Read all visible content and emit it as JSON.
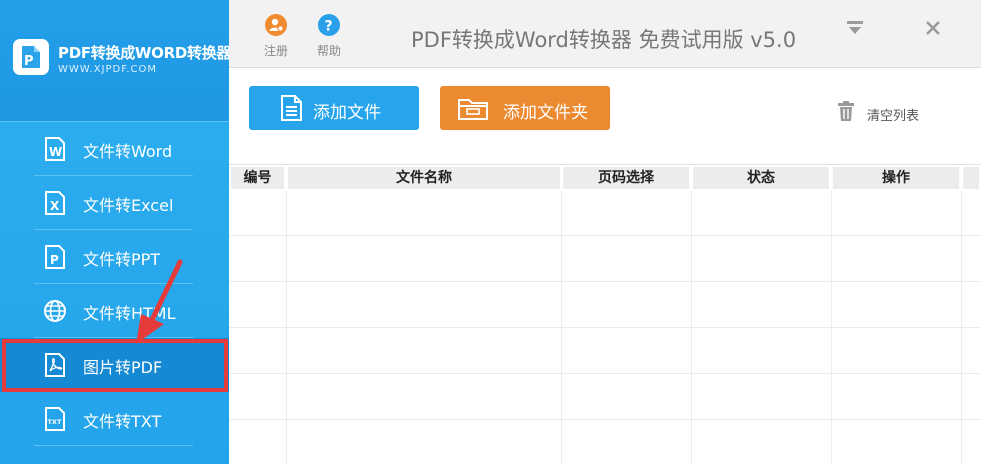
{
  "brand": {
    "name": "PDF转换成WORD转换器",
    "url": "WWW.XJPDF.COM"
  },
  "sidebar": {
    "items": [
      {
        "label": "文件转Word",
        "icon": "word-doc-icon"
      },
      {
        "label": "文件转Excel",
        "icon": "excel-doc-icon"
      },
      {
        "label": "文件转PPT",
        "icon": "ppt-doc-icon"
      },
      {
        "label": "文件转HTML",
        "icon": "globe-icon"
      },
      {
        "label": "图片转PDF",
        "icon": "pdf-doc-icon",
        "active": true
      },
      {
        "label": "文件转TXT",
        "icon": "txt-doc-icon"
      }
    ]
  },
  "titlebar": {
    "register_label": "注册",
    "help_label": "帮助",
    "title": "PDF转换成Word转换器 免费试用版 v5.0"
  },
  "toolbar": {
    "add_file_label": "添加文件",
    "add_folder_label": "添加文件夹",
    "clear_list_label": "清空列表"
  },
  "table": {
    "columns": [
      "编号",
      "文件名称",
      "页码选择",
      "状态",
      "操作"
    ],
    "rows": []
  },
  "colors": {
    "sidebar": "#2eb0f0",
    "active_item": "#1589d3",
    "add_file_button": "#27a5ec",
    "add_folder_button": "#ec8a31",
    "annotation_red": "#e63b3b",
    "register_icon": "#f08a2e",
    "help_icon": "#2aa0ea"
  }
}
